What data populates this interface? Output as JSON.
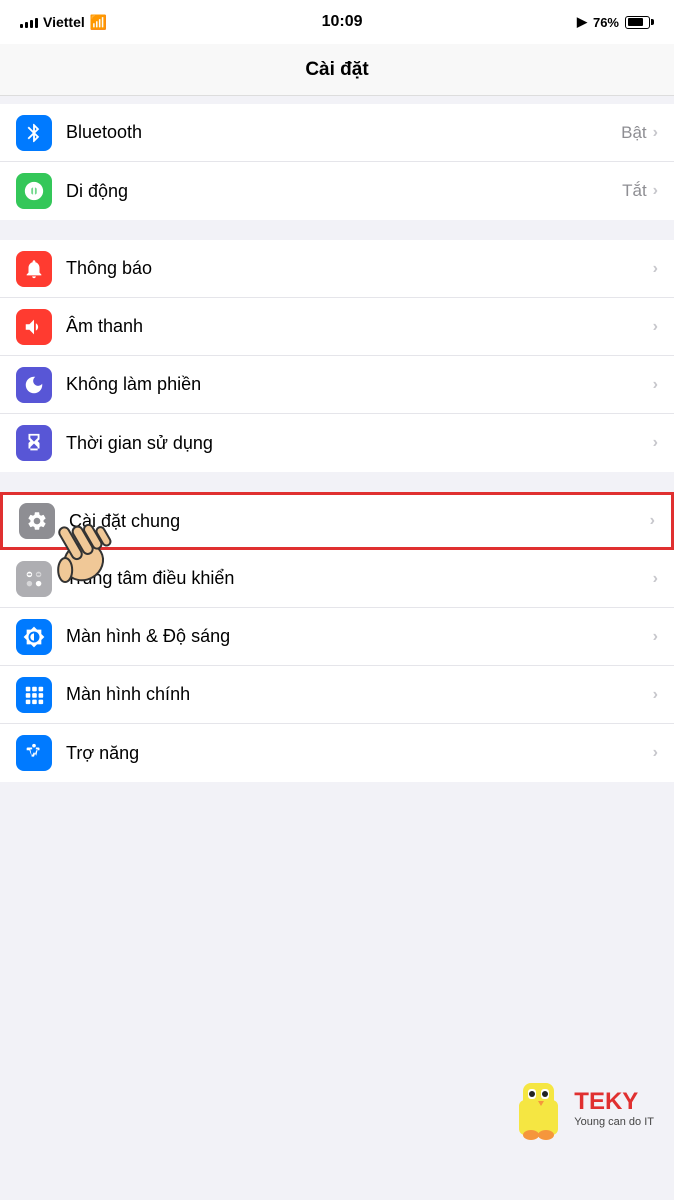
{
  "statusBar": {
    "carrier": "Viettel",
    "time": "10:09",
    "battery": "76%",
    "batteryFill": "76"
  },
  "navBar": {
    "title": "Cài đặt"
  },
  "groups": [
    {
      "id": "group1",
      "items": [
        {
          "id": "bluetooth",
          "label": "Bluetooth",
          "value": "Bật",
          "iconColor": "blue",
          "iconSymbol": "bluetooth"
        },
        {
          "id": "mobile",
          "label": "Di động",
          "value": "Tắt",
          "iconColor": "green",
          "iconSymbol": "mobile"
        }
      ]
    },
    {
      "id": "group2",
      "items": [
        {
          "id": "notifications",
          "label": "Thông báo",
          "value": "",
          "iconColor": "red",
          "iconSymbol": "notifications"
        },
        {
          "id": "sounds",
          "label": "Âm thanh",
          "value": "",
          "iconColor": "red",
          "iconSymbol": "sounds"
        },
        {
          "id": "dnd",
          "label": "Không làm phiền",
          "value": "",
          "iconColor": "purple",
          "iconSymbol": "moon"
        },
        {
          "id": "screentime",
          "label": "Thời gian sử dụng",
          "value": "",
          "iconColor": "purple-dark",
          "iconSymbol": "hourglass"
        }
      ]
    },
    {
      "id": "group3",
      "items": [
        {
          "id": "general",
          "label": "Cài đặt chung",
          "value": "",
          "iconColor": "gray",
          "iconSymbol": "gear",
          "highlighted": true
        },
        {
          "id": "controlcenter",
          "label": "Trung tâm điều khiển",
          "value": "",
          "iconColor": "light-gray",
          "iconSymbol": "controls"
        },
        {
          "id": "display",
          "label": "Màn hình & Độ sáng",
          "value": "",
          "iconColor": "blue",
          "iconSymbol": "brightness"
        },
        {
          "id": "homescreen",
          "label": "Màn hình chính",
          "value": "",
          "iconColor": "blue",
          "iconSymbol": "grid"
        },
        {
          "id": "accessibility",
          "label": "Trợ năng",
          "value": "",
          "iconColor": "blue",
          "iconSymbol": "accessibility"
        }
      ]
    }
  ]
}
